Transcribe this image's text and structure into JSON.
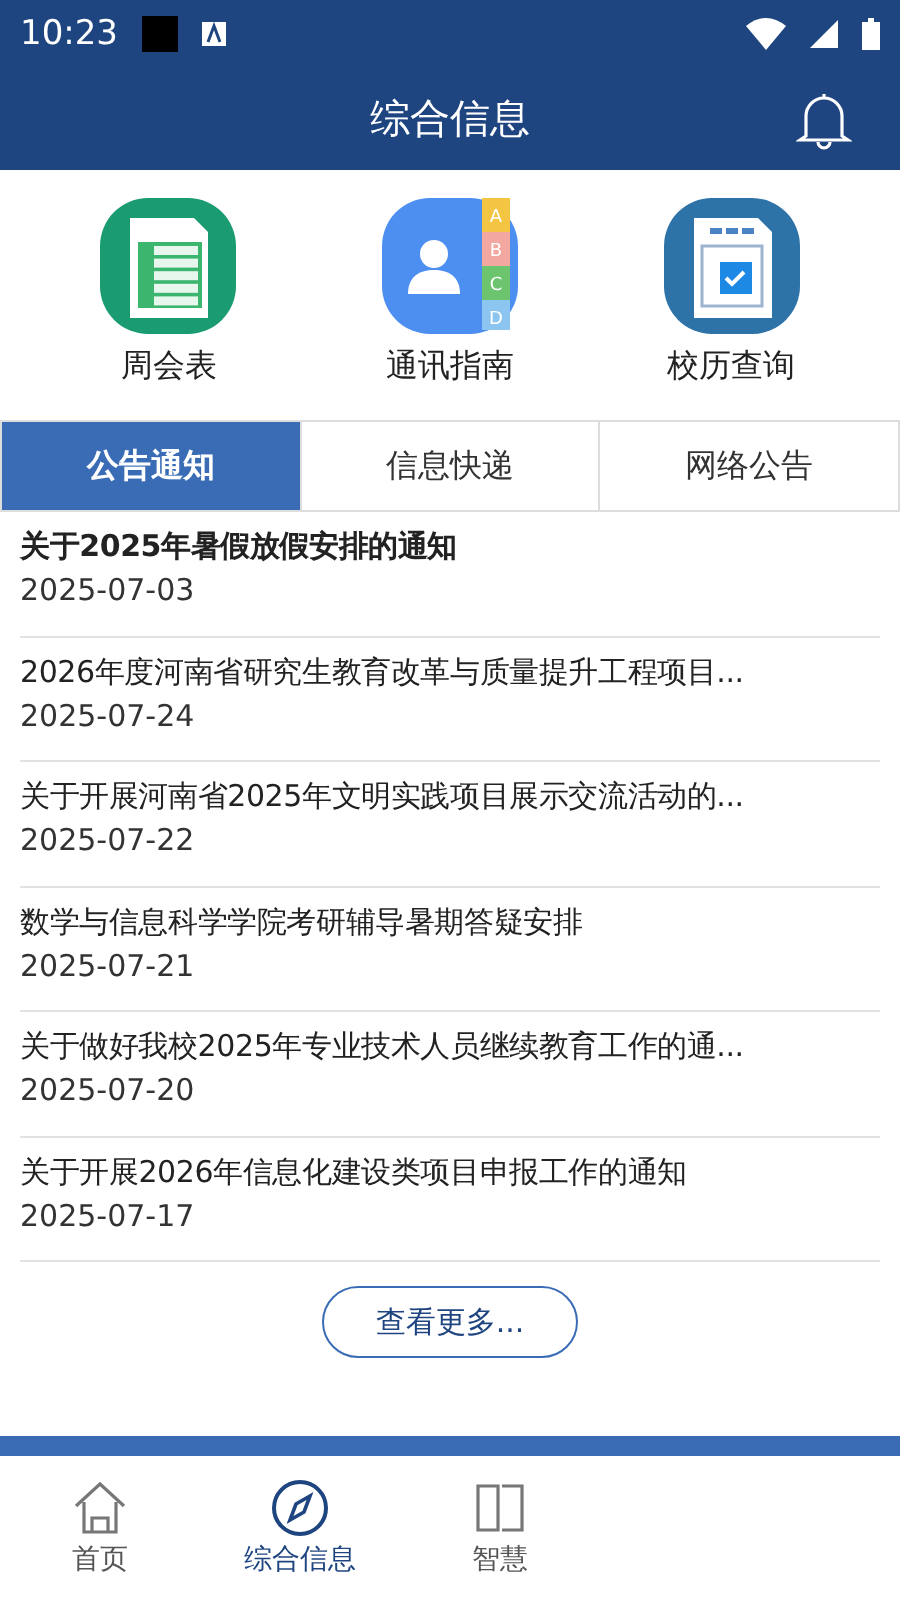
{
  "status_bar": {
    "time": "10:23"
  },
  "header": {
    "title": "综合信息"
  },
  "shortcuts": [
    {
      "kind": "sheet",
      "label": "周会表"
    },
    {
      "kind": "contacts",
      "label": "通讯指南",
      "index_letters": [
        "A",
        "B",
        "C",
        "D"
      ]
    },
    {
      "kind": "calendar",
      "label": "校历查询"
    }
  ],
  "tabs": [
    {
      "label": "公告通知",
      "selected": true
    },
    {
      "label": "信息快递",
      "selected": false
    },
    {
      "label": "网络公告",
      "selected": false
    }
  ],
  "notices": [
    {
      "title": "关于2025年暑假放假安排的通知",
      "date": "2025-07-03",
      "bold": true
    },
    {
      "title": "2026年度河南省研究生教育改革与质量提升工程项目...",
      "date": "2025-07-24",
      "bold": false
    },
    {
      "title": "关于开展河南省2025年文明实践项目展示交流活动的...",
      "date": "2025-07-22",
      "bold": false
    },
    {
      "title": "数学与信息科学学院考研辅导暑期答疑安排",
      "date": "2025-07-21",
      "bold": false
    },
    {
      "title": "关于做好我校2025年专业技术人员继续教育工作的通...",
      "date": "2025-07-20",
      "bold": false
    },
    {
      "title": "关于开展2026年信息化建设类项目申报工作的通知",
      "date": "2025-07-17",
      "bold": false
    }
  ],
  "more_button": "查看更多...",
  "bottom_nav": [
    {
      "kind": "home",
      "label": "首页",
      "selected": false
    },
    {
      "kind": "compass",
      "label": "综合信息",
      "selected": true
    },
    {
      "kind": "book",
      "label": "智慧",
      "selected": false
    }
  ]
}
